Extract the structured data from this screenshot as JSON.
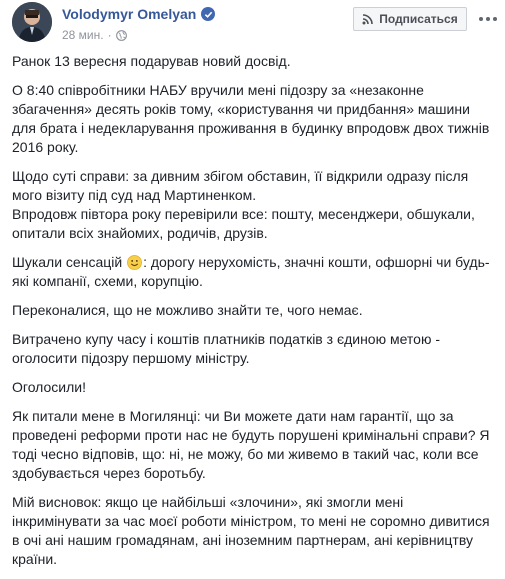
{
  "post": {
    "author": "Volodymyr Omelyan",
    "time": "28 мин.",
    "subscribe_label": "Подписаться",
    "paragraphs": [
      "Ранок 13 вересня подарував новий досвід.",
      "О 8:40 співробітники НАБУ вручили мені підозру за «незаконне збагачення» десять років тому, «користування чи придбання» машини для брата і недекларування проживання в будинку впродовж двох тижнів 2016 року.",
      "Щодо суті справи: за дивним збігом обставин, її відкрили одразу після мого візиту під суд над Мартиненком.",
      "Впродовж півтора року перевірили все: пошту, месенджери, обшукали, опитали всіх знайомих, родичів, друзів.",
      "Переконалися, що не можливо знайти те, чого немає.",
      "Витрачено купу часу і коштів платників податків з єдиною метою - оголосити підозру першому міністру.",
      "Оголосили!",
      "Як питали мене в Могилянці: чи Ви можете дати нам гарантії, що за проведені реформи проти нас не будуть порушені кримінальні справи? Я тоді чесно відповів, що: ні, не можу, бо ми живемо в такий час, коли все здобувається через боротьбу.",
      "Мій висновок: якщо це найбільші «злочини», які змогли мені інкримінувати за час моєї роботи міністром, то мені не соромно дивитися в очі ані нашим громадянам, ані іноземним партнерам, ані керівництву країни."
    ],
    "sensations": {
      "before": "Шукали сенсацій",
      "after": ": дорогу нерухомість, значні кошти, офшорні чи будь-які компанії, схеми, корупцію."
    }
  },
  "icons": {
    "verified": "verified-badge-icon",
    "globe": "globe-icon",
    "rss": "rss-icon",
    "more": "more-options-icon",
    "emoji": "smiley-emoji-icon"
  },
  "colors": {
    "author": "#365899",
    "verified": "#4267b2",
    "text": "#1d2129",
    "meta": "#90949c"
  }
}
